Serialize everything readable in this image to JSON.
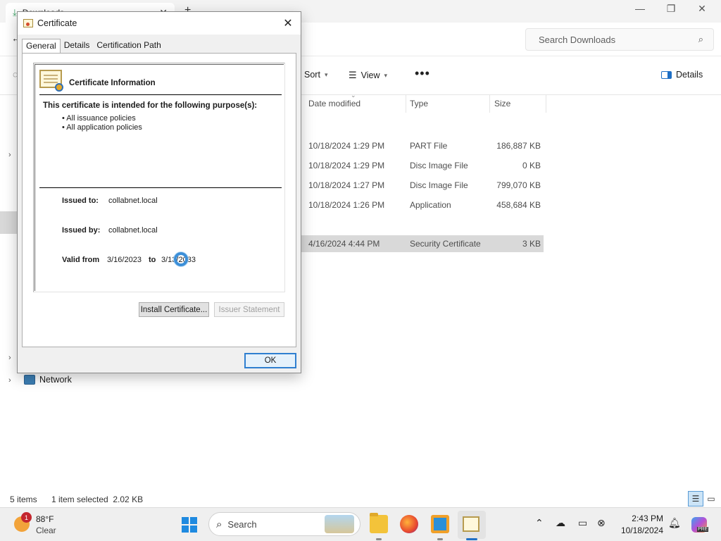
{
  "explorer": {
    "tab_title": "Downloads",
    "search_placeholder": "Search Downloads",
    "toolbar": {
      "sort_label": "Sort",
      "view_label": "View",
      "more_label": "•••",
      "details_label": "Details"
    },
    "columns": [
      "Date modified",
      "Type",
      "Size"
    ],
    "rows": [
      {
        "date": "10/18/2024 1:29 PM",
        "type": "PART File",
        "size": "186,887 KB",
        "selected": false
      },
      {
        "date": "10/18/2024 1:29 PM",
        "type": "Disc Image File",
        "size": "0 KB",
        "selected": false
      },
      {
        "date": "10/18/2024 1:27 PM",
        "type": "Disc Image File",
        "size": "799,070 KB",
        "selected": false
      },
      {
        "date": "10/18/2024 1:26 PM",
        "type": "Application",
        "size": "458,684 KB",
        "selected": false
      },
      {
        "date": "4/16/2024 4:44 PM",
        "type": "Security Certificate",
        "size": "3 KB",
        "selected": true
      }
    ],
    "nav": {
      "network_label": "Network"
    },
    "status": {
      "item_count": "5 items",
      "selection": "1 item selected  2.02 KB"
    }
  },
  "dialog": {
    "title": "Certificate",
    "tabs": [
      "General",
      "Details",
      "Certification Path"
    ],
    "info_title": "Certificate Information",
    "purpose_heading": "This certificate is intended for the following purpose(s):",
    "purposes": [
      "• All issuance policies",
      "• All application policies"
    ],
    "issued_to_label": "Issued to:",
    "issued_to": "collabnet.local",
    "issued_by_label": "Issued by:",
    "issued_by": "collabnet.local",
    "valid_from_label": "Valid from",
    "valid_from": "3/16/2023",
    "to_label": "to",
    "valid_to": "3/13/2033",
    "install_button": "Install Certificate...",
    "issuer_statement_button": "Issuer Statement",
    "ok_button": "OK"
  },
  "taskbar": {
    "weather_temp": "88°F",
    "weather_condition": "Clear",
    "weather_badge": "1",
    "search_label": "Search",
    "time": "2:43 PM",
    "date": "10/18/2024",
    "copilot_badge": "PRE"
  }
}
